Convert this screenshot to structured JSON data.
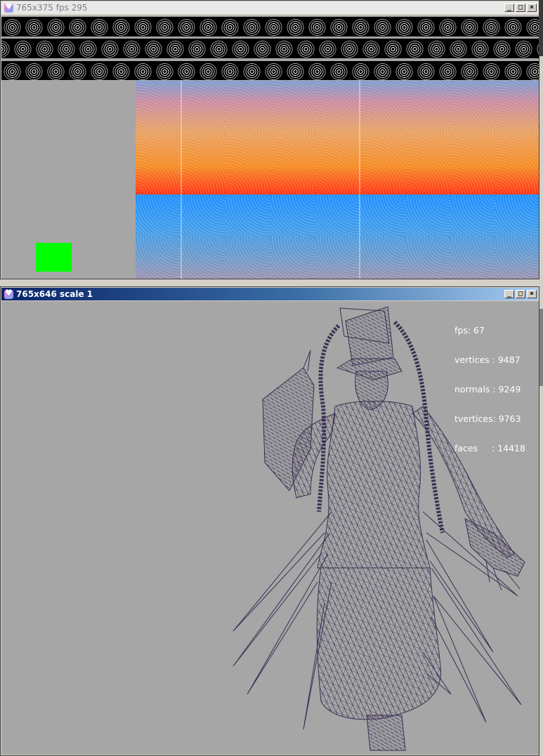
{
  "top_window": {
    "title": "765x375 fps 295",
    "buttons": {
      "minimize": "_",
      "maximize": "□",
      "close": "×"
    }
  },
  "bottom_window": {
    "title": "765x646 scale 1",
    "buttons": {
      "minimize": "_",
      "maximize": "□",
      "close": "×"
    },
    "stats": [
      "fps: 67",
      "vertices : 9487",
      "normals : 9249",
      "tvertices: 9763",
      "faces     : 14418"
    ]
  },
  "colors": {
    "viewport_bg": "#a6a6a6",
    "wireframe": "#3a2f52",
    "marker": "#00ff00",
    "titlebar_active": "#0a246a"
  },
  "icons": [
    "app-heart-icon",
    "minimize-icon",
    "maximize-icon",
    "close-icon"
  ]
}
